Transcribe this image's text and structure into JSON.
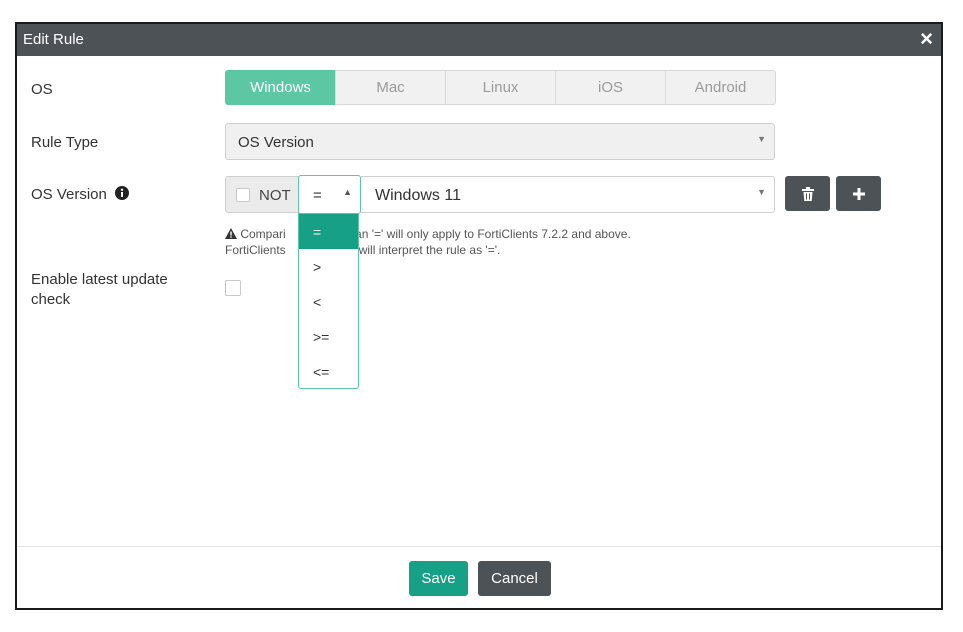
{
  "dialog": {
    "title": "Edit Rule",
    "close_label": "×"
  },
  "os": {
    "label": "OS",
    "options": [
      "Windows",
      "Mac",
      "Linux",
      "iOS",
      "Android"
    ],
    "selected": "Windows"
  },
  "rule_type": {
    "label": "Rule Type",
    "value": "OS Version"
  },
  "os_version": {
    "label": "OS Version",
    "not_label": "NOT",
    "operator": "=",
    "value": "Windows 11",
    "operator_options": [
      "=",
      ">",
      "<",
      ">=",
      "<="
    ],
    "note_prefix": "Compari",
    "note_line1_rest": "r than '=' will only apply to FortiClients 7.2.2 and above.",
    "note_line2_prefix": "FortiClients",
    "note_line2_rest": "2 will interpret the rule as '='."
  },
  "latest_update": {
    "label_line1": "Enable latest update",
    "label_line2": "check"
  },
  "footer": {
    "save_label": "Save",
    "cancel_label": "Cancel"
  },
  "colors": {
    "accent": "#5bc7a3",
    "accent_dark": "#16a085",
    "titlebar": "#4d5257"
  },
  "icons": [
    "info-icon",
    "caret-up-icon",
    "caret-down-icon",
    "trash-icon",
    "plus-icon",
    "warning-icon",
    "close-icon"
  ]
}
